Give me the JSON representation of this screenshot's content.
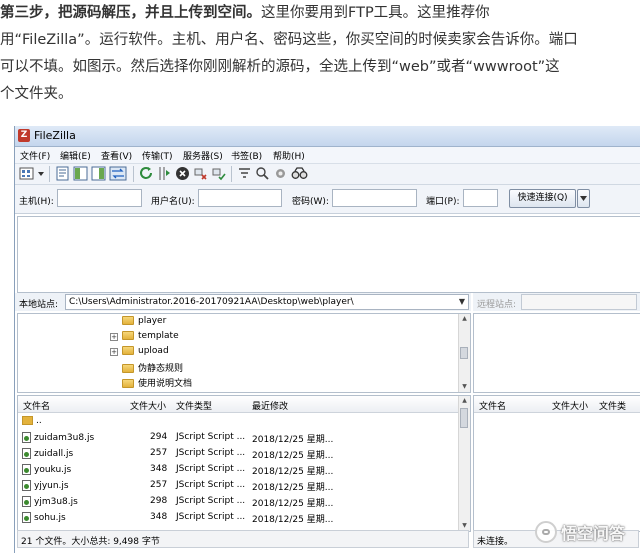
{
  "article": {
    "line1_bold": "第三步，把源码解压，并且上传到空间。",
    "line1_rest": "这里你要用到FTP工具。这里推荐你",
    "line2": "用“FileZilla”。运行软件。主机、用户名、密码这些，你买空间的时候卖家会告诉你。端口",
    "line3": "可以不填。如图示。然后选择你刚刚解析的源码，全选上传到“web”或者“wwwroot”这",
    "line4": "个文件夹。"
  },
  "window": {
    "title": "FileZilla",
    "logo_letter": "Z"
  },
  "menu": [
    "文件(F)",
    "编辑(E)",
    "查看(V)",
    "传输(T)",
    "服务器(S)",
    "书签(B)",
    "帮助(H)"
  ],
  "toolbar_icons": [
    "site-manager-icon",
    "dropdown-arrow-icon",
    "toggle-log-icon",
    "toggle-local-tree-icon",
    "toggle-remote-tree-icon",
    "toggle-queue-icon",
    "refresh-icon",
    "process-queue-icon",
    "cancel-icon",
    "disconnect-icon",
    "reconnect-icon",
    "filter-icon",
    "compare-icon",
    "sync-browse-icon",
    "search-icon"
  ],
  "connection": {
    "host_label": "主机(H):",
    "user_label": "用户名(U):",
    "password_label": "密码(W):",
    "port_label": "端口(P):",
    "quickconnect_label": "快速连接(Q)",
    "host_value": "",
    "user_value": "",
    "password_value": "",
    "port_value": ""
  },
  "local": {
    "site_label": "本地站点:",
    "path": "C:\\Users\\Administrator.2016-20170921AA\\Desktop\\web\\player\\",
    "tree": [
      {
        "name": "player",
        "expander": ""
      },
      {
        "name": "template",
        "expander": "+"
      },
      {
        "name": "upload",
        "expander": "+"
      },
      {
        "name": "伪静态规则",
        "expander": ""
      },
      {
        "name": "使用说明文档",
        "expander": ""
      }
    ],
    "columns": {
      "name": "文件名",
      "size": "文件大小",
      "type": "文件类型",
      "modified": "最近修改"
    },
    "files": [
      {
        "name": "..",
        "size": "",
        "type": "",
        "modified": ""
      },
      {
        "name": "zuidam3u8.js",
        "size": "294",
        "type": "JScript Script ...",
        "modified": "2018/12/25 星期..."
      },
      {
        "name": "zuidall.js",
        "size": "257",
        "type": "JScript Script ...",
        "modified": "2018/12/25 星期..."
      },
      {
        "name": "youku.js",
        "size": "348",
        "type": "JScript Script ...",
        "modified": "2018/12/25 星期..."
      },
      {
        "name": "yjyun.js",
        "size": "257",
        "type": "JScript Script ...",
        "modified": "2018/12/25 星期..."
      },
      {
        "name": "yjm3u8.js",
        "size": "298",
        "type": "JScript Script ...",
        "modified": "2018/12/25 星期..."
      },
      {
        "name": "sohu.js",
        "size": "348",
        "type": "JScript Script ...",
        "modified": "2018/12/25 星期..."
      }
    ],
    "status": "21 个文件。大小总共: 9,498 字节"
  },
  "remote": {
    "site_label": "远程站点:",
    "columns": {
      "name": "文件名",
      "size": "文件大小",
      "type": "文件类"
    },
    "status": "未连接。"
  },
  "watermark": {
    "text": "悟空问答"
  }
}
